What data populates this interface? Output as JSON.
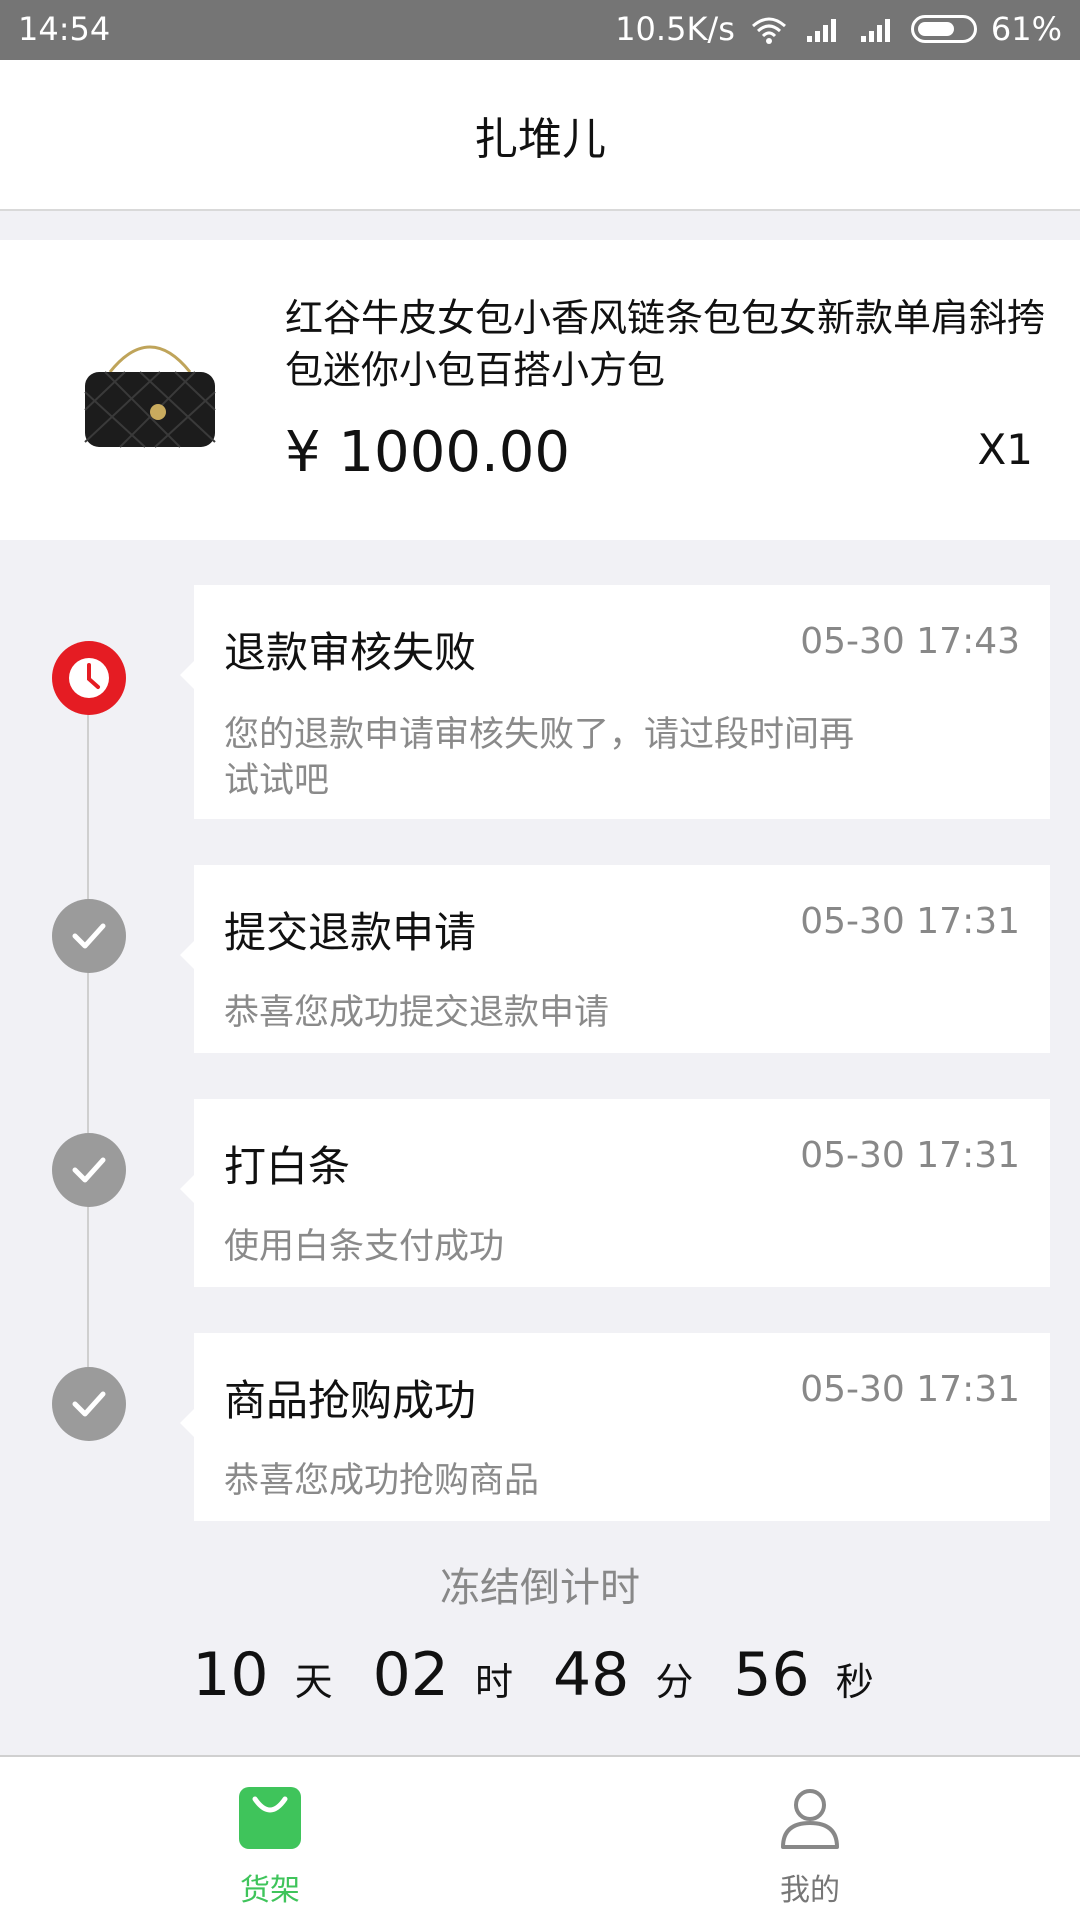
{
  "status_bar": {
    "time": "14:54",
    "speed": "10.5K/s",
    "battery": "61%"
  },
  "header": {
    "title": "扎堆儿"
  },
  "product": {
    "name": "红谷牛皮女包小香风链条包包女新款单肩斜挎包迷你小包百搭小方包",
    "price": "¥ 1000.00",
    "quantity": "X1"
  },
  "timeline": [
    {
      "title": "退款审核失败",
      "time": "05-30 17:43",
      "desc": "您的退款申请审核失败了，请过段时间再试试吧",
      "status": "failed"
    },
    {
      "title": "提交退款申请",
      "time": "05-30 17:31",
      "desc": "恭喜您成功提交退款申请",
      "status": "done"
    },
    {
      "title": "打白条",
      "time": "05-30 17:31",
      "desc": "使用白条支付成功",
      "status": "done"
    },
    {
      "title": "商品抢购成功",
      "time": "05-30 17:31",
      "desc": "恭喜您成功抢购商品",
      "status": "done"
    }
  ],
  "countdown": {
    "label": "冻结倒计时",
    "days": "10",
    "days_unit": "天",
    "hours": "02",
    "hours_unit": "时",
    "minutes": "48",
    "minutes_unit": "分",
    "seconds": "56",
    "seconds_unit": "秒"
  },
  "tabbar": {
    "shelf": "货架",
    "mine": "我的"
  },
  "colors": {
    "accent_green": "#3fc45b",
    "failed_red": "#e51c23",
    "done_gray": "#9b9b9b"
  }
}
